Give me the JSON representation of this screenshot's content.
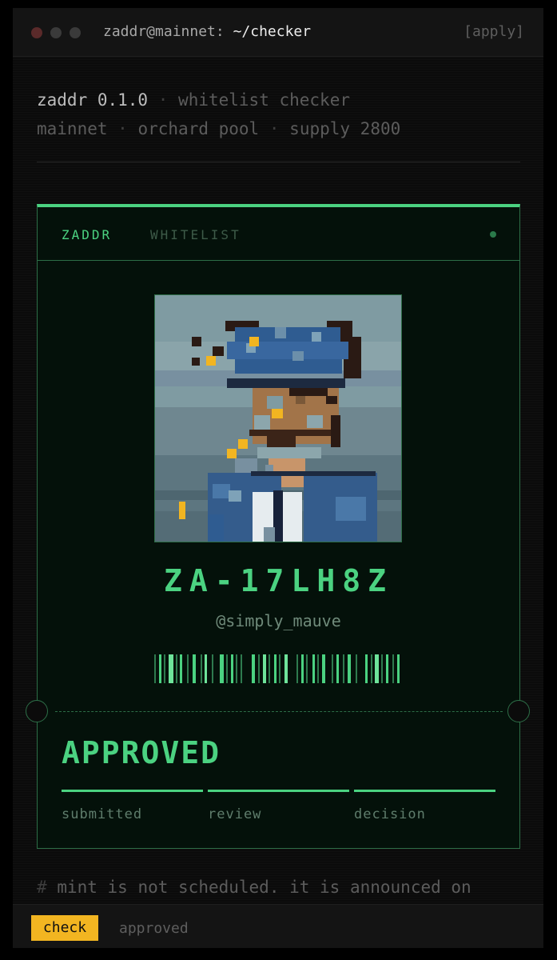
{
  "window": {
    "user_host": "zaddr@mainnet:",
    "path": "~/checker",
    "apply_label": "[apply]"
  },
  "info": {
    "line1_name": "zaddr 0.1.0",
    "line1_sep": "·",
    "line1_desc": "whitelist checker",
    "line2_network": "mainnet",
    "line2_sep1": "·",
    "line2_pool": "orchard pool",
    "line2_sep2": "·",
    "line2_supply": "supply 2800"
  },
  "card": {
    "tab_zaddr": "ZADDR",
    "tab_whitelist": "WHITELIST",
    "id": "ZA-17LH8Z",
    "handle": "@simply_mauve",
    "status": "APPROVED",
    "steps": [
      {
        "label": "submitted"
      },
      {
        "label": "review"
      },
      {
        "label": "decision"
      }
    ]
  },
  "footer": {
    "comment_hash": "#",
    "comment": "mint is not scheduled. it is announced on",
    "check_button": "check",
    "status_text": "approved"
  },
  "colors": {
    "accent": "#4bd281",
    "button": "#f2b521",
    "background": "#0b0b0b"
  }
}
